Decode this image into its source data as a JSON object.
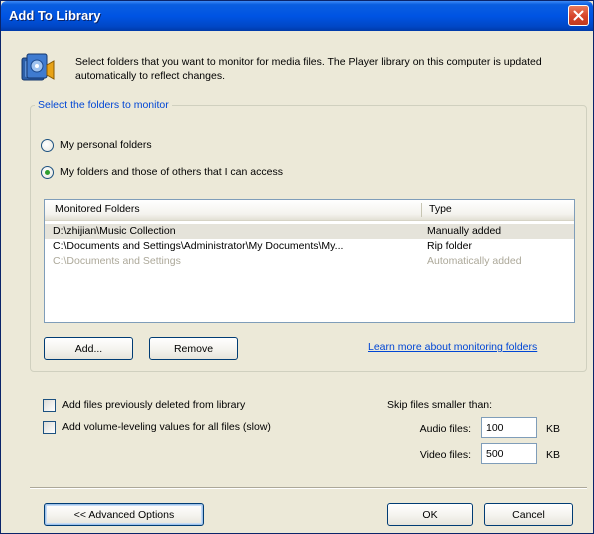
{
  "window": {
    "title": "Add To Library"
  },
  "intro": {
    "description": "Select folders that you want to monitor for media files. The Player library on this computer is updated automatically to reflect changes.",
    "icon": "media-library-icon"
  },
  "monitor": {
    "group_label": "Select the folders to monitor",
    "radio_personal": "My personal folders",
    "radio_all": "My folders and those of others that I can access",
    "selected": "radio_all"
  },
  "folders": {
    "columns": [
      "Monitored Folders",
      "Type"
    ],
    "rows": [
      {
        "path": "D:\\zhijian\\Music Collection",
        "type": "Manually added",
        "state": "selected"
      },
      {
        "path": "C:\\Documents and Settings\\Administrator\\My Documents\\My...",
        "type": "Rip folder",
        "state": "normal"
      },
      {
        "path": "C:\\Documents and Settings",
        "type": "Automatically added",
        "state": "disabled"
      }
    ]
  },
  "buttons": {
    "add": "Add...",
    "remove": "Remove",
    "advanced": "<< Advanced Options",
    "ok": "OK",
    "cancel": "Cancel"
  },
  "learn_more_link": "Learn more about monitoring folders",
  "options": {
    "add_deleted": "Add files previously deleted from library",
    "add_volume": "Add volume-leveling values for all files (slow)",
    "add_deleted_checked": false,
    "add_volume_checked": false
  },
  "skip": {
    "label": "Skip files smaller than:",
    "audio_label": "Audio files:",
    "audio_value": "100",
    "video_label": "Video files:",
    "video_value": "500",
    "unit": "KB"
  },
  "colors": {
    "titlebar": "#0054e3",
    "dialog_background": "#ece9d8",
    "link": "#0046d5",
    "group_label": "#0046d5"
  }
}
